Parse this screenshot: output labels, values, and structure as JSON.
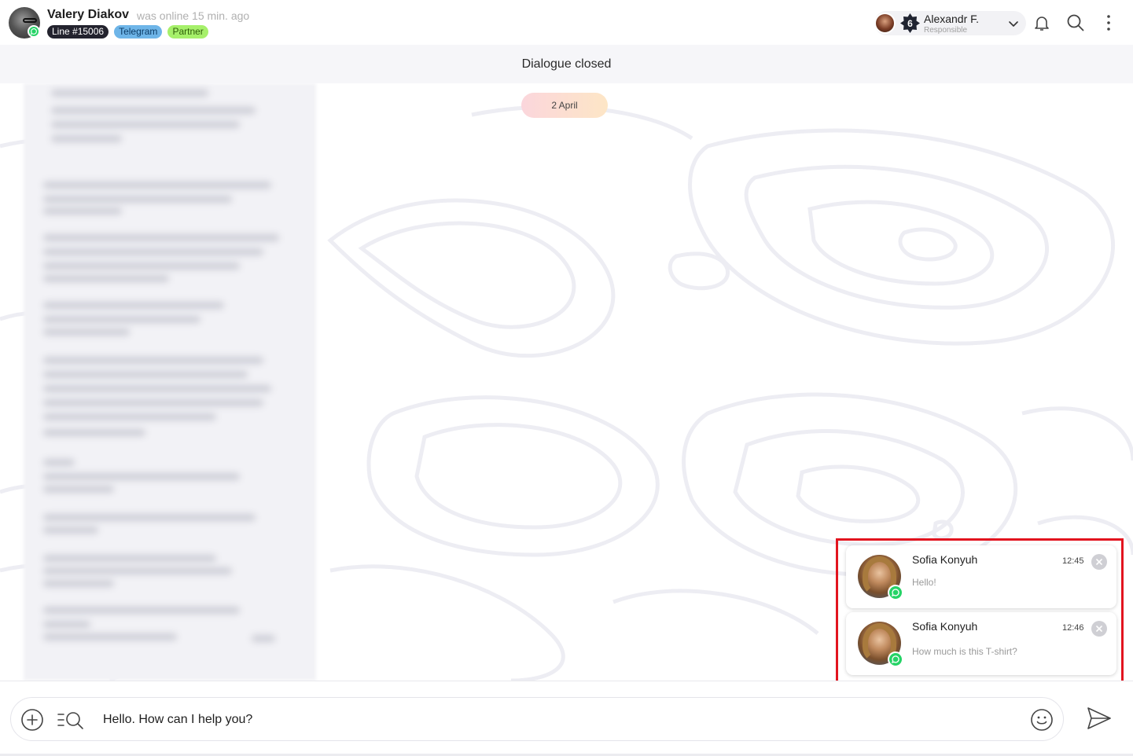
{
  "header": {
    "contact_name": "Valery Diakov",
    "last_seen": "was online 15 min. ago",
    "tags": [
      "Line #15006",
      "Telegram",
      "Partner"
    ],
    "responsible": {
      "badge_count": "6",
      "name": "Alexandr F.",
      "role": "Responsible"
    }
  },
  "status_bar": {
    "text": "Dialogue closed"
  },
  "chat": {
    "date_separator": "2 April"
  },
  "notifications": [
    {
      "sender": "Sofia Konyuh",
      "time": "12:45",
      "message": "Hello!",
      "channel": "whatsapp"
    },
    {
      "sender": "Sofia Konyuh",
      "time": "12:46",
      "message": "How much is this T-shirt?",
      "channel": "whatsapp"
    }
  ],
  "composer": {
    "input_value": "Hello. How can I help you?"
  },
  "colors": {
    "whatsapp": "#25d366",
    "highlight": "#e2141f",
    "tag_line": "#23232e",
    "tag_telegram": "#6eb5e8",
    "tag_partner": "#a6f06a"
  }
}
